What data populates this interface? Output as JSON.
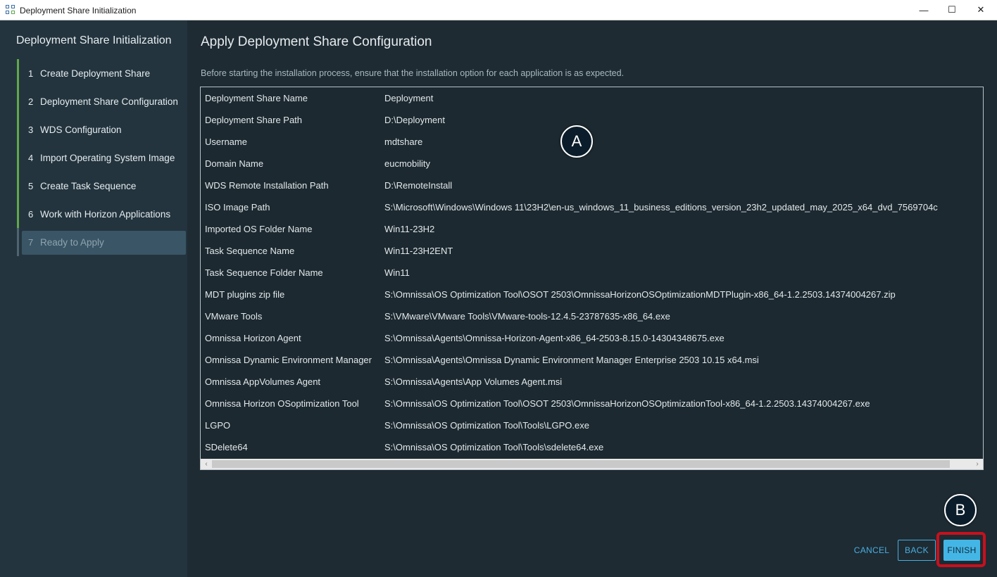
{
  "window": {
    "title": "Deployment Share Initialization",
    "controls": {
      "minimize": "—",
      "maximize": "☐",
      "close": "✕"
    }
  },
  "sidebar": {
    "title": "Deployment Share Initialization",
    "steps": [
      {
        "num": "1",
        "label": "Create Deployment Share"
      },
      {
        "num": "2",
        "label": "Deployment Share Configuration"
      },
      {
        "num": "3",
        "label": "WDS Configuration"
      },
      {
        "num": "4",
        "label": "Import Operating System Image"
      },
      {
        "num": "5",
        "label": "Create Task Sequence"
      },
      {
        "num": "6",
        "label": "Work with Horizon Applications"
      },
      {
        "num": "7",
        "label": "Ready to Apply"
      }
    ]
  },
  "main": {
    "title": "Apply Deployment Share Configuration",
    "description": "Before starting the installation process, ensure that the installation option for each application is as expected.",
    "rows": [
      {
        "key": "Deployment Share Name",
        "value": "Deployment"
      },
      {
        "key": "Deployment Share Path",
        "value": "D:\\Deployment"
      },
      {
        "key": "Username",
        "value": "mdtshare"
      },
      {
        "key": "Domain Name",
        "value": "eucmobility"
      },
      {
        "key": "WDS Remote Installation Path",
        "value": "D:\\RemoteInstall"
      },
      {
        "key": "ISO Image Path",
        "value": "S:\\Microsoft\\Windows\\Windows 11\\23H2\\en-us_windows_11_business_editions_version_23h2_updated_may_2025_x64_dvd_7569704c"
      },
      {
        "key": "Imported OS Folder Name",
        "value": "Win11-23H2"
      },
      {
        "key": "Task Sequence Name",
        "value": "Win11-23H2ENT"
      },
      {
        "key": "Task Sequence Folder Name",
        "value": "Win11"
      },
      {
        "key": "MDT plugins zip file",
        "value": "S:\\Omnissa\\OS Optimization Tool\\OSOT 2503\\OmnissaHorizonOSOptimizationMDTPlugin-x86_64-1.2.2503.14374004267.zip"
      },
      {
        "key": "VMware Tools",
        "value": "S:\\VMware\\VMware Tools\\VMware-tools-12.4.5-23787635-x86_64.exe"
      },
      {
        "key": "Omnissa Horizon Agent",
        "value": "S:\\Omnissa\\Agents\\Omnissa-Horizon-Agent-x86_64-2503-8.15.0-14304348675.exe"
      },
      {
        "key": "Omnissa Dynamic Environment Manager",
        "value": "S:\\Omnissa\\Agents\\Omnissa Dynamic Environment Manager Enterprise 2503 10.15 x64.msi"
      },
      {
        "key": "Omnissa AppVolumes Agent",
        "value": "S:\\Omnissa\\Agents\\App Volumes Agent.msi"
      },
      {
        "key": "Omnissa Horizon OSoptimization Tool",
        "value": "S:\\Omnissa\\OS Optimization Tool\\OSOT 2503\\OmnissaHorizonOSOptimizationTool-x86_64-1.2.2503.14374004267.exe"
      },
      {
        "key": "LGPO",
        "value": "S:\\Omnissa\\OS Optimization Tool\\Tools\\LGPO.exe"
      },
      {
        "key": "SDelete64",
        "value": "S:\\Omnissa\\OS Optimization Tool\\Tools\\sdelete64.exe"
      }
    ]
  },
  "callouts": {
    "a": "A",
    "b": "B"
  },
  "footer": {
    "cancel": "CANCEL",
    "back": "BACK",
    "finish": "FINISH"
  },
  "colors": {
    "accent": "#44b6e6",
    "step_done": "#5fa84a",
    "highlight_frame": "#c8101d"
  }
}
